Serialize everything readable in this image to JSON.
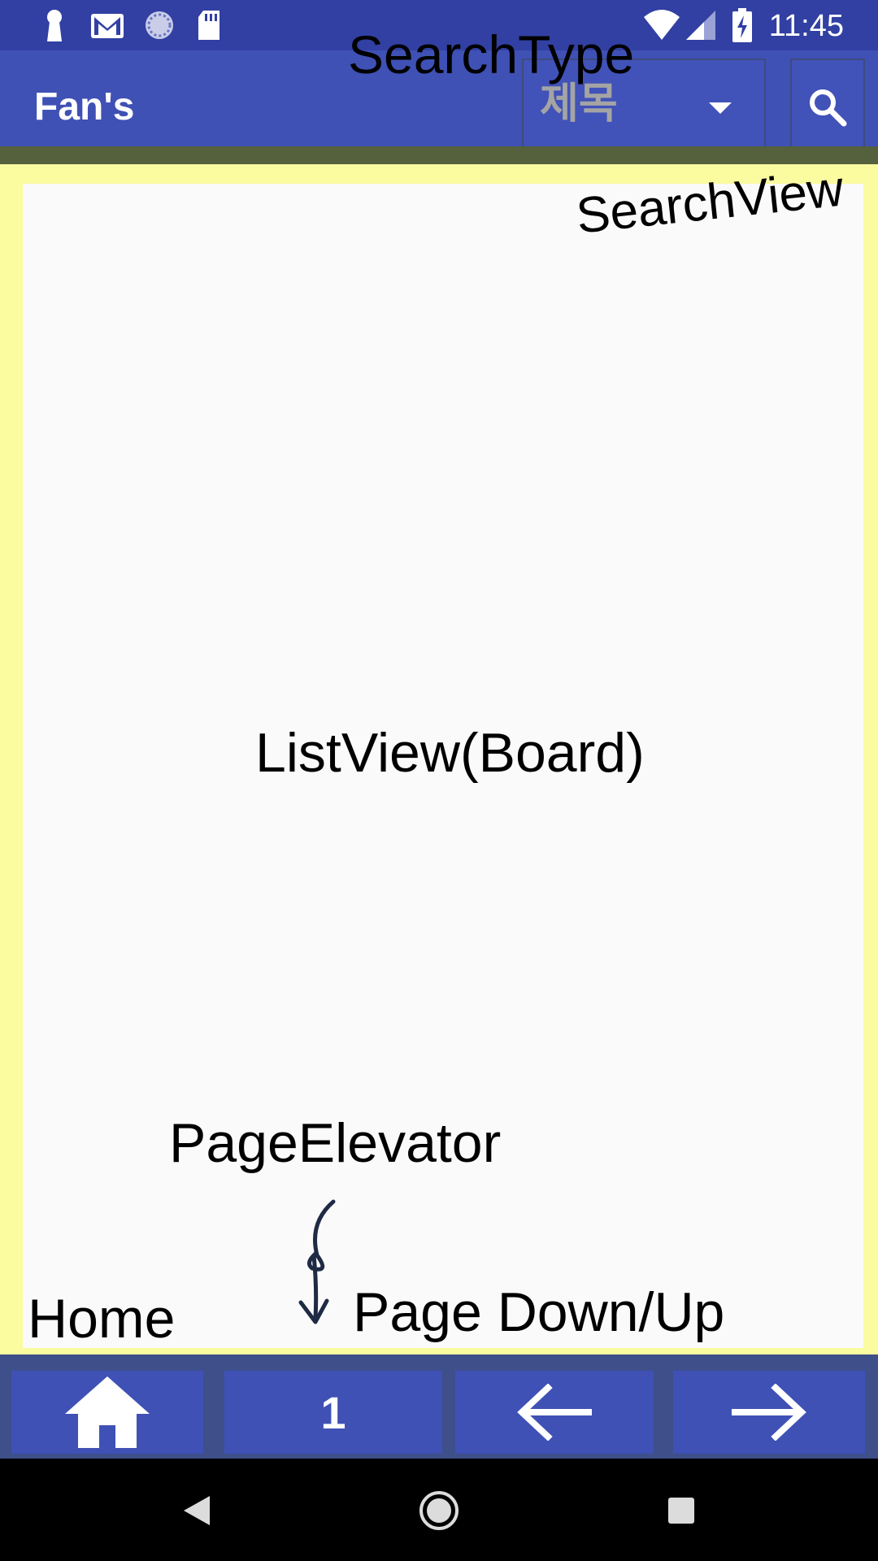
{
  "status_bar": {
    "time": "11:45",
    "icons": [
      "keyhole-icon",
      "gmail-icon",
      "sync-icon",
      "sd-card-icon",
      "wifi-icon",
      "signal-icon",
      "battery-charging-icon"
    ]
  },
  "toolbar": {
    "title": "Fan's",
    "search_type_value": "제목",
    "search_icon": "search-icon"
  },
  "annotations": {
    "search_type": "SearchType",
    "search_view": "SearchView",
    "list_view": "ListView(Board)",
    "page_elevator": "PageElevator",
    "home": "Home",
    "page_down_up": "Page Down/Up"
  },
  "bottom_bar": {
    "home_icon": "home-icon",
    "page_number": "1",
    "prev_icon": "arrow-left-icon",
    "next_icon": "arrow-right-icon"
  },
  "nav_bar": {
    "back_icon": "back-icon",
    "home_icon": "home-circle-icon",
    "recents_icon": "recents-icon"
  },
  "colors": {
    "status_bar": "#3140a2",
    "toolbar": "#3f51b5",
    "highlight": "#fbfba0",
    "content": "#fafafa",
    "bottom_bar": "#3e4f8a"
  }
}
